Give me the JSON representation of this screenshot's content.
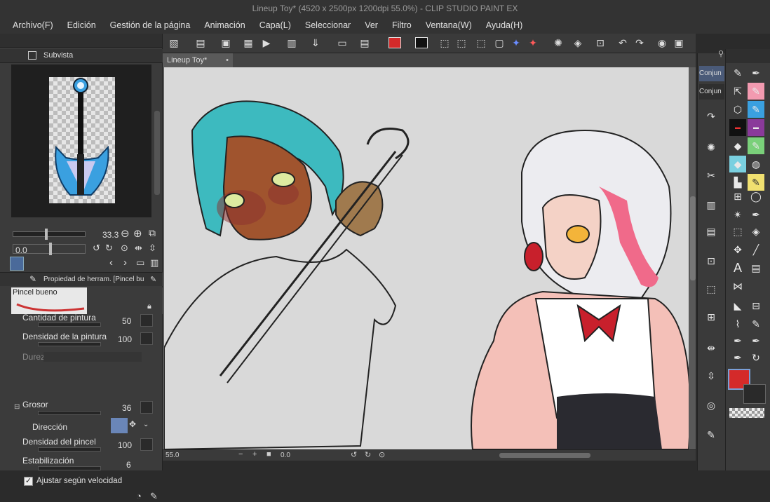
{
  "window": {
    "title": "Lineup Toy* (4520 x 2500px 1200dpi 55.0%)  - CLIP STUDIO PAINT EX"
  },
  "menu": [
    "Archivo(F)",
    "Edición",
    "Gestión de la página",
    "Animación",
    "Capa(L)",
    "Seleccionar",
    "Ver",
    "Filtro",
    "Ventana(W)",
    "Ayuda(H)"
  ],
  "subview": {
    "title": "Subvista",
    "zoom": "33.3",
    "angle": "0.0"
  },
  "tool_property": {
    "title": "Propiedad de herram. [Pincel bu",
    "brush_name": "Pincel bueno",
    "rows": [
      {
        "label": "Cantidad de pintura",
        "value": "50"
      },
      {
        "label": "Densidad de la pintura",
        "value": "100"
      },
      {
        "label": "Dureza",
        "value": ""
      },
      {
        "label": "Grosor",
        "value": "36"
      },
      {
        "label": "Dirección",
        "value": ""
      },
      {
        "label": "Densidad del pincel",
        "value": "100"
      },
      {
        "label": "Estabilización",
        "value": "6"
      }
    ],
    "checkbox_label": "Ajustar según velocidad"
  },
  "canvas": {
    "tab_label": "Lineup Toy*",
    "status_zoom": "55.0",
    "status_angle": "0.0"
  },
  "right_panel": {
    "tab1": "Conjun",
    "tab2": "Conjun"
  },
  "colors": {
    "main": "#d42a2a",
    "sub": "#2a2a2a"
  }
}
